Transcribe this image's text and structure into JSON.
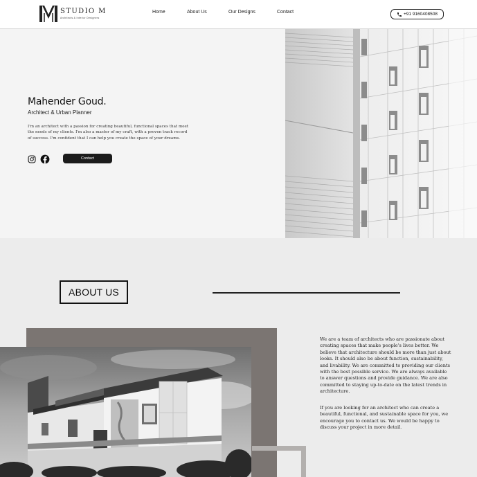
{
  "header": {
    "brand": "STUDIO M",
    "brand_sub": "Architects & Interior Designers",
    "logo_icon": "m-monogram-icon",
    "nav": [
      "Home",
      "About Us",
      "Our Designs",
      "Contact"
    ],
    "phone": "+91 9160408508",
    "phone_icon": "phone-icon"
  },
  "hero": {
    "name": "Mahender Goud.",
    "role": "Architect & Urban Planner",
    "description": "I'm an architect with a passion for creating beautiful, functional spaces that meet the needs of my clients. I'm also a master of my craft, with a proven track record of success. I'm confident that I can help you create the space of your dreams.",
    "social_icons": [
      "instagram-icon",
      "facebook-icon"
    ],
    "contact_label": "Contact"
  },
  "about": {
    "title": "ABOUT US",
    "paragraph1": "We are a team of architects who are passionate about creating spaces that make people's lives better. We believe that architecture should be more than just about looks. It should also be about function, sustainability, and livability. We are committed to providing our clients with the best possible service. We are always available to answer questions and provide guidance. We are also committed to staying up-to-date on the latest trends in architecture.",
    "paragraph2": "If you are looking for an architect who can create a beautiful, functional, and sustainable space for you, we encourage you to contact us. We would be happy to discuss your project in more detail."
  },
  "colors": {
    "header_bg": "#ffffff",
    "hero_bg": "#f4f4f4",
    "about_bg": "#ececec",
    "button_dark": "#1b1b1b",
    "about_block": "#7b7572",
    "frame": "#b3b0ae"
  }
}
